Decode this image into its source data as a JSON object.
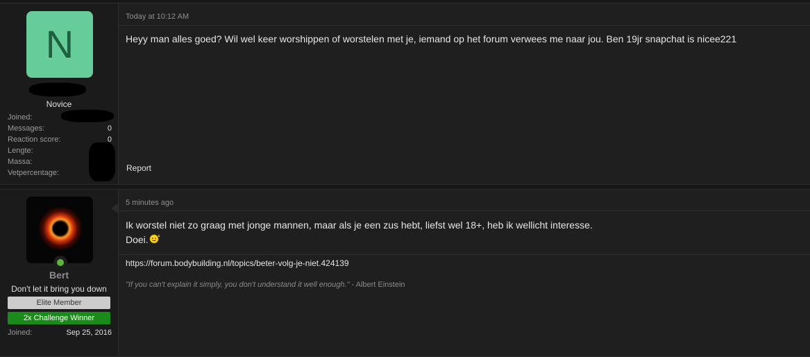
{
  "posts": [
    {
      "avatar_letter": "N",
      "user_title": "Novice",
      "stats": [
        {
          "label": "Joined:",
          "value": ""
        },
        {
          "label": "Messages:",
          "value": "0"
        },
        {
          "label": "Reaction score:",
          "value": "0"
        },
        {
          "label": "Lengte:",
          "value": ""
        },
        {
          "label": "Massa:",
          "value": ""
        },
        {
          "label": "Vetpercentage:",
          "value": ""
        }
      ],
      "time": "Today at 10:12 AM",
      "body": "Heyy man alles goed? Wil wel keer worshippen of worstelen met je, iemand op het forum verwees me naar jou. Ben 19jr snapchat is nicee221",
      "report_label": "Report"
    },
    {
      "username": "Bert",
      "user_title": "Don't let it bring you down",
      "badges": [
        "Elite Member",
        "2x Challenge Winner"
      ],
      "stats": [
        {
          "label": "Joined:",
          "value": "Sep 25, 2016"
        }
      ],
      "time": "5 minutes ago",
      "body_line1": "Ik worstel niet zo graag met jonge mannen, maar als je een zus hebt, liefst wel 18+, heb ik wellicht interesse.",
      "body_line2": "Doei.",
      "signature_link": "https://forum.bodybuilding.nl/topics/beter-volg-je-niet.424139",
      "signature_quote": "\"If you can't explain it simply, you don't understand it well enough.\"",
      "signature_author": " - Albert Einstein"
    }
  ],
  "colors": {
    "avatar_bg": "#66cc99",
    "online": "#5bb43c",
    "elite_badge": "#cccccc",
    "challenge_badge": "#1a8a1a"
  },
  "icons": {
    "smiley": "smiley-wave-icon",
    "online": "online-indicator-icon"
  }
}
